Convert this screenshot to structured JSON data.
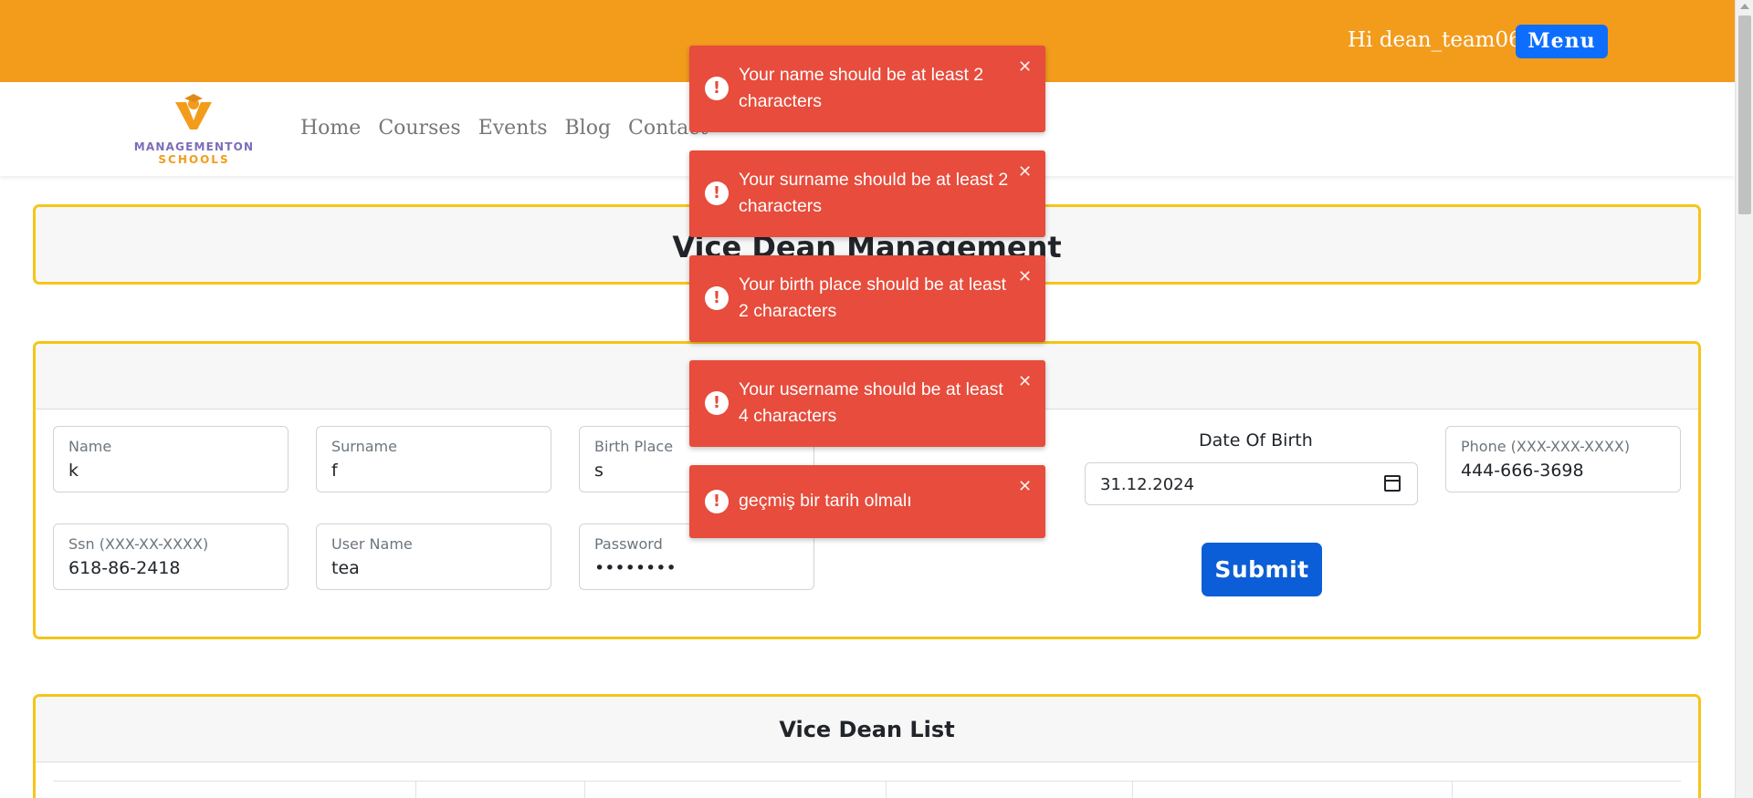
{
  "topbar": {
    "greeting": "Hi dean_team06",
    "menu_label": "Menu"
  },
  "logo": {
    "line1": "MANAGEMENTON",
    "line2": "SCHOOLS"
  },
  "nav": {
    "links": [
      "Home",
      "Courses",
      "Events",
      "Blog",
      "Contact"
    ]
  },
  "page": {
    "title": "Vice Dean Management"
  },
  "form": {
    "name": {
      "label": "Name",
      "value": "k"
    },
    "surname": {
      "label": "Surname",
      "value": "f"
    },
    "birth_place": {
      "label": "Birth Place",
      "value": "s"
    },
    "phone": {
      "label": "Phone (XXX-XXX-XXXX)",
      "value": "444-666-3698"
    },
    "ssn": {
      "label": "Ssn (XXX-XX-XXXX)",
      "value": "618-86-2418"
    },
    "username": {
      "label": "User Name",
      "value": "tea"
    },
    "password": {
      "label": "Password",
      "value": "••••••••"
    },
    "dob": {
      "label": "Date Of Birth",
      "value": "31.12.2024"
    },
    "submit_label": "Submit"
  },
  "list": {
    "title": "Vice Dean List"
  },
  "toasts": [
    {
      "message": "Your name should be at least 2 characters",
      "close": "✕"
    },
    {
      "message": "Your surname should be at least 2 characters",
      "close": "✕"
    },
    {
      "message": "Your birth place should be at least 2 characters",
      "close": "✕"
    },
    {
      "message": "Your username should be at least 4 characters",
      "close": "✕"
    },
    {
      "message": "geçmiş bir tarih olmalı",
      "close": "✕"
    }
  ],
  "colors": {
    "topbar": "#f39c1c",
    "accent": "#0d6efd",
    "toast": "#e74c3c",
    "panel_border": "#f5c518"
  }
}
